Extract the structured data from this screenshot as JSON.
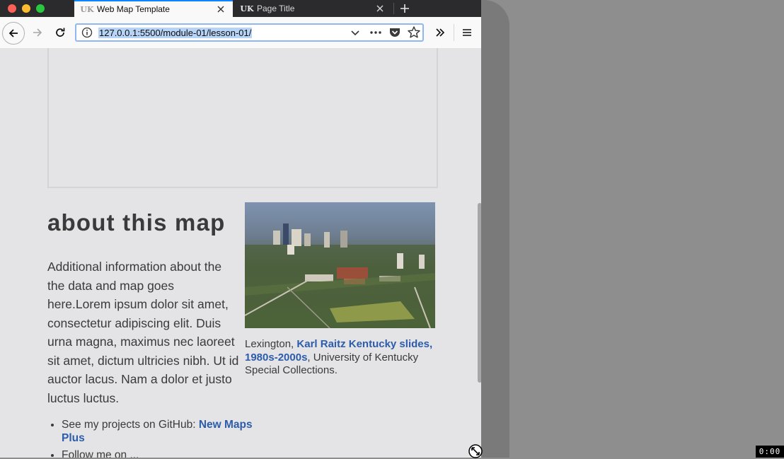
{
  "browser": {
    "tabs": [
      {
        "title": "Web Map Template",
        "favicon": "uk-logo-icon",
        "active": true
      },
      {
        "title": "Page Title",
        "favicon": "uk-logo-icon",
        "active": false
      }
    ],
    "favicon_text": "UK",
    "url": "127.0.0.1:5500/module-01/lesson-01/",
    "accent_color": "#0a84ff"
  },
  "page": {
    "heading": "about this map",
    "description": "Additional information about the the data and map goes here.Lorem ipsum dolor sit amet, consectetur adipiscing elit. Duis urna magna, maximus nec laoreet sit amet, dictum ultricies nibh. Ut id auctor lacus. Nam a dolor et justo luctus luctus.",
    "caption": {
      "prefix": "Lexington, ",
      "link": "Karl Raitz Kentucky slides, 1980s-2000s",
      "suffix": ", University of Kentucky Special Collections."
    },
    "list": [
      {
        "text": "See my projects on GitHub: ",
        "link": "New Maps Plus"
      },
      {
        "text": "Follow me on ..."
      }
    ],
    "link_color": "#2c5cab"
  },
  "overlay": {
    "timer": "0:00"
  }
}
